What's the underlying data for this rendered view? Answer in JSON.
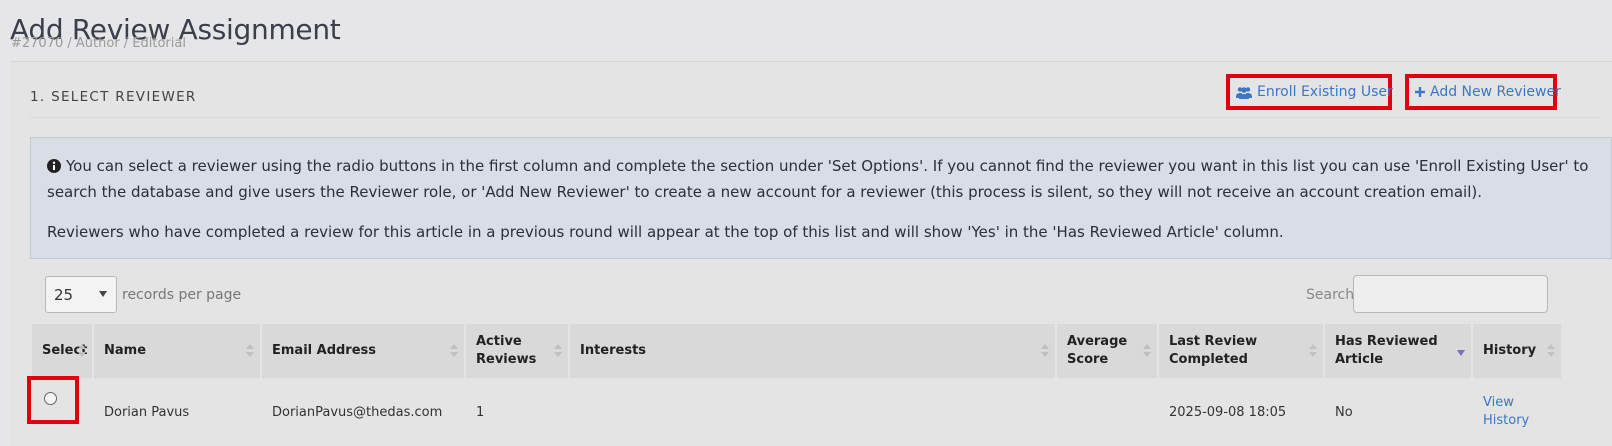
{
  "page": {
    "title": "Add Review Assignment",
    "breadcrumb": "#27070 / Author / Editorial"
  },
  "section": {
    "title": "1. SELECT REVIEWER",
    "enroll_label": "Enroll Existing User",
    "add_label": "Add New Reviewer",
    "enroll_icon": "users-icon",
    "add_icon": "plus-icon"
  },
  "info": {
    "icon": "info-circle-icon",
    "p1": "You can select a reviewer using the radio buttons in the first column and complete the section under 'Set Options'. If you cannot find the reviewer you want in this list you can use 'Enroll Existing User' to search the database and give users the Reviewer role, or 'Add New Reviewer' to create a new account for a reviewer (this process is silent, so they will not receive an account creation email).",
    "p2": "Reviewers who have completed a review for this article in a previous round will appear at the top of this list and will show 'Yes' in the 'Has Reviewed Article' column."
  },
  "table_controls": {
    "page_length": "25",
    "length_label": "records per page",
    "search_label": "Search:"
  },
  "columns": {
    "select": "Select",
    "name": "Name",
    "email": "Email Address",
    "active": "Active Reviews",
    "interests": "Interests",
    "avg": "Average Score",
    "last": "Last Review Completed",
    "has": "Has Reviewed Article",
    "history": "History"
  },
  "rows": [
    {
      "name": "Dorian Pavus",
      "email": "DorianPavus@thedas.com",
      "active": "1",
      "interests": "",
      "avg": "",
      "last": "2025-09-08 18:05",
      "has": "No",
      "history": "View History"
    }
  ],
  "colors": {
    "highlight": "#e00010",
    "link": "#3b77c4",
    "info_bg": "#d8dde6"
  }
}
